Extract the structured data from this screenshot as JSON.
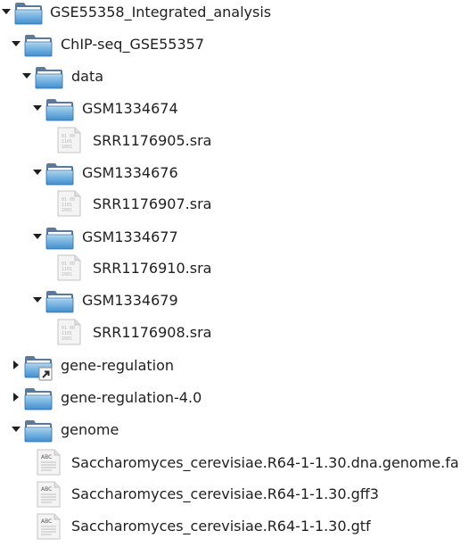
{
  "tree": {
    "root": {
      "label": "GSE55358_Integrated_analysis",
      "icon": "folder-icon",
      "state": "expanded"
    },
    "chip": {
      "label": "ChIP-seq_GSE55357",
      "icon": "folder-icon",
      "state": "expanded"
    },
    "data": {
      "label": "data",
      "icon": "folder-icon",
      "state": "expanded"
    },
    "gsm1": {
      "label": "GSM1334674",
      "icon": "folder-icon",
      "state": "expanded"
    },
    "sra1": {
      "label": "SRR1176905.sra",
      "icon": "binary-file-icon"
    },
    "gsm2": {
      "label": "GSM1334676",
      "icon": "folder-icon",
      "state": "expanded"
    },
    "sra2": {
      "label": "SRR1176907.sra",
      "icon": "binary-file-icon"
    },
    "gsm3": {
      "label": "GSM1334677",
      "icon": "folder-icon",
      "state": "expanded"
    },
    "sra3": {
      "label": "SRR1176910.sra",
      "icon": "binary-file-icon"
    },
    "gsm4": {
      "label": "GSM1334679",
      "icon": "folder-icon",
      "state": "expanded"
    },
    "sra4": {
      "label": "SRR1176908.sra",
      "icon": "binary-file-icon"
    },
    "generegulation": {
      "label": "gene-regulation",
      "icon": "folder-link-icon",
      "state": "collapsed"
    },
    "generegulation40": {
      "label": "gene-regulation-4.0",
      "icon": "folder-icon",
      "state": "collapsed"
    },
    "genome": {
      "label": "genome",
      "icon": "folder-icon",
      "state": "expanded"
    },
    "fa": {
      "label": "Saccharomyces_cerevisiae.R64-1-1.30.dna.genome.fa",
      "icon": "text-file-icon"
    },
    "gff3": {
      "label": "Saccharomyces_cerevisiae.R64-1-1.30.gff3",
      "icon": "text-file-icon"
    },
    "gtf": {
      "label": "Saccharomyces_cerevisiae.R64-1-1.30.gtf",
      "icon": "text-file-icon"
    }
  },
  "colors": {
    "folder_top": "#8fc3e6",
    "folder_bottom": "#3d8fcf",
    "text": "#1f1f1f",
    "arrow": "#1f1f1f"
  }
}
